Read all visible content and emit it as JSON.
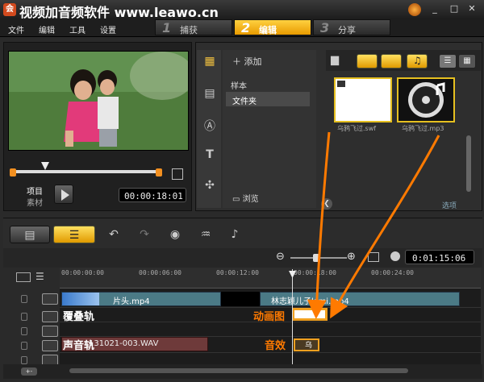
{
  "titlebar": {
    "title": "视频加音频软件 www.leawo.cn",
    "icon": "app-logo-icon",
    "controls": [
      "minimize-icon",
      "maximize-icon",
      "close-icon"
    ]
  },
  "menu": {
    "file": "文件",
    "edit": "编辑",
    "tools": "工具",
    "settings": "设置"
  },
  "steps": [
    {
      "num": "1",
      "label": "捕获",
      "active": false
    },
    {
      "num": "2",
      "label": "编辑",
      "active": true
    },
    {
      "num": "3",
      "label": "分享",
      "active": false
    }
  ],
  "preview": {
    "mode_project": "项目",
    "mode_clip": "素材",
    "timecode": "00:00:18:01"
  },
  "library": {
    "add_label": "添加",
    "categories": [
      "样本",
      "文件夹"
    ],
    "selected_category": "文件夹",
    "browse_label": "浏览",
    "options_label": "选项",
    "items": [
      {
        "name": "乌鸦飞过.swf",
        "icon": "flash-file-icon"
      },
      {
        "name": "乌鸦飞过.mp3",
        "icon": "audio-disc-icon"
      }
    ]
  },
  "timeline": {
    "duration": "0:01:15:06",
    "ruler": [
      "00:00:00:00",
      "00:00:06:00",
      "00:00:12:00",
      "00:00:18:00",
      "00:00:24:00"
    ],
    "clips": {
      "video1": "片头.mp4",
      "video2": "林志颖儿子kimi.mp4",
      "audio": "131021-003.WAV",
      "sfx": "乌"
    },
    "track_labels": {
      "overlay": "覆叠轨",
      "voice": "声音轨"
    },
    "annotations": {
      "flash": "动画图",
      "sfx": "音效"
    }
  },
  "colors": {
    "accent": "#f0a020",
    "active_tab": "#ffd040",
    "annotation": "#ff7a00"
  }
}
